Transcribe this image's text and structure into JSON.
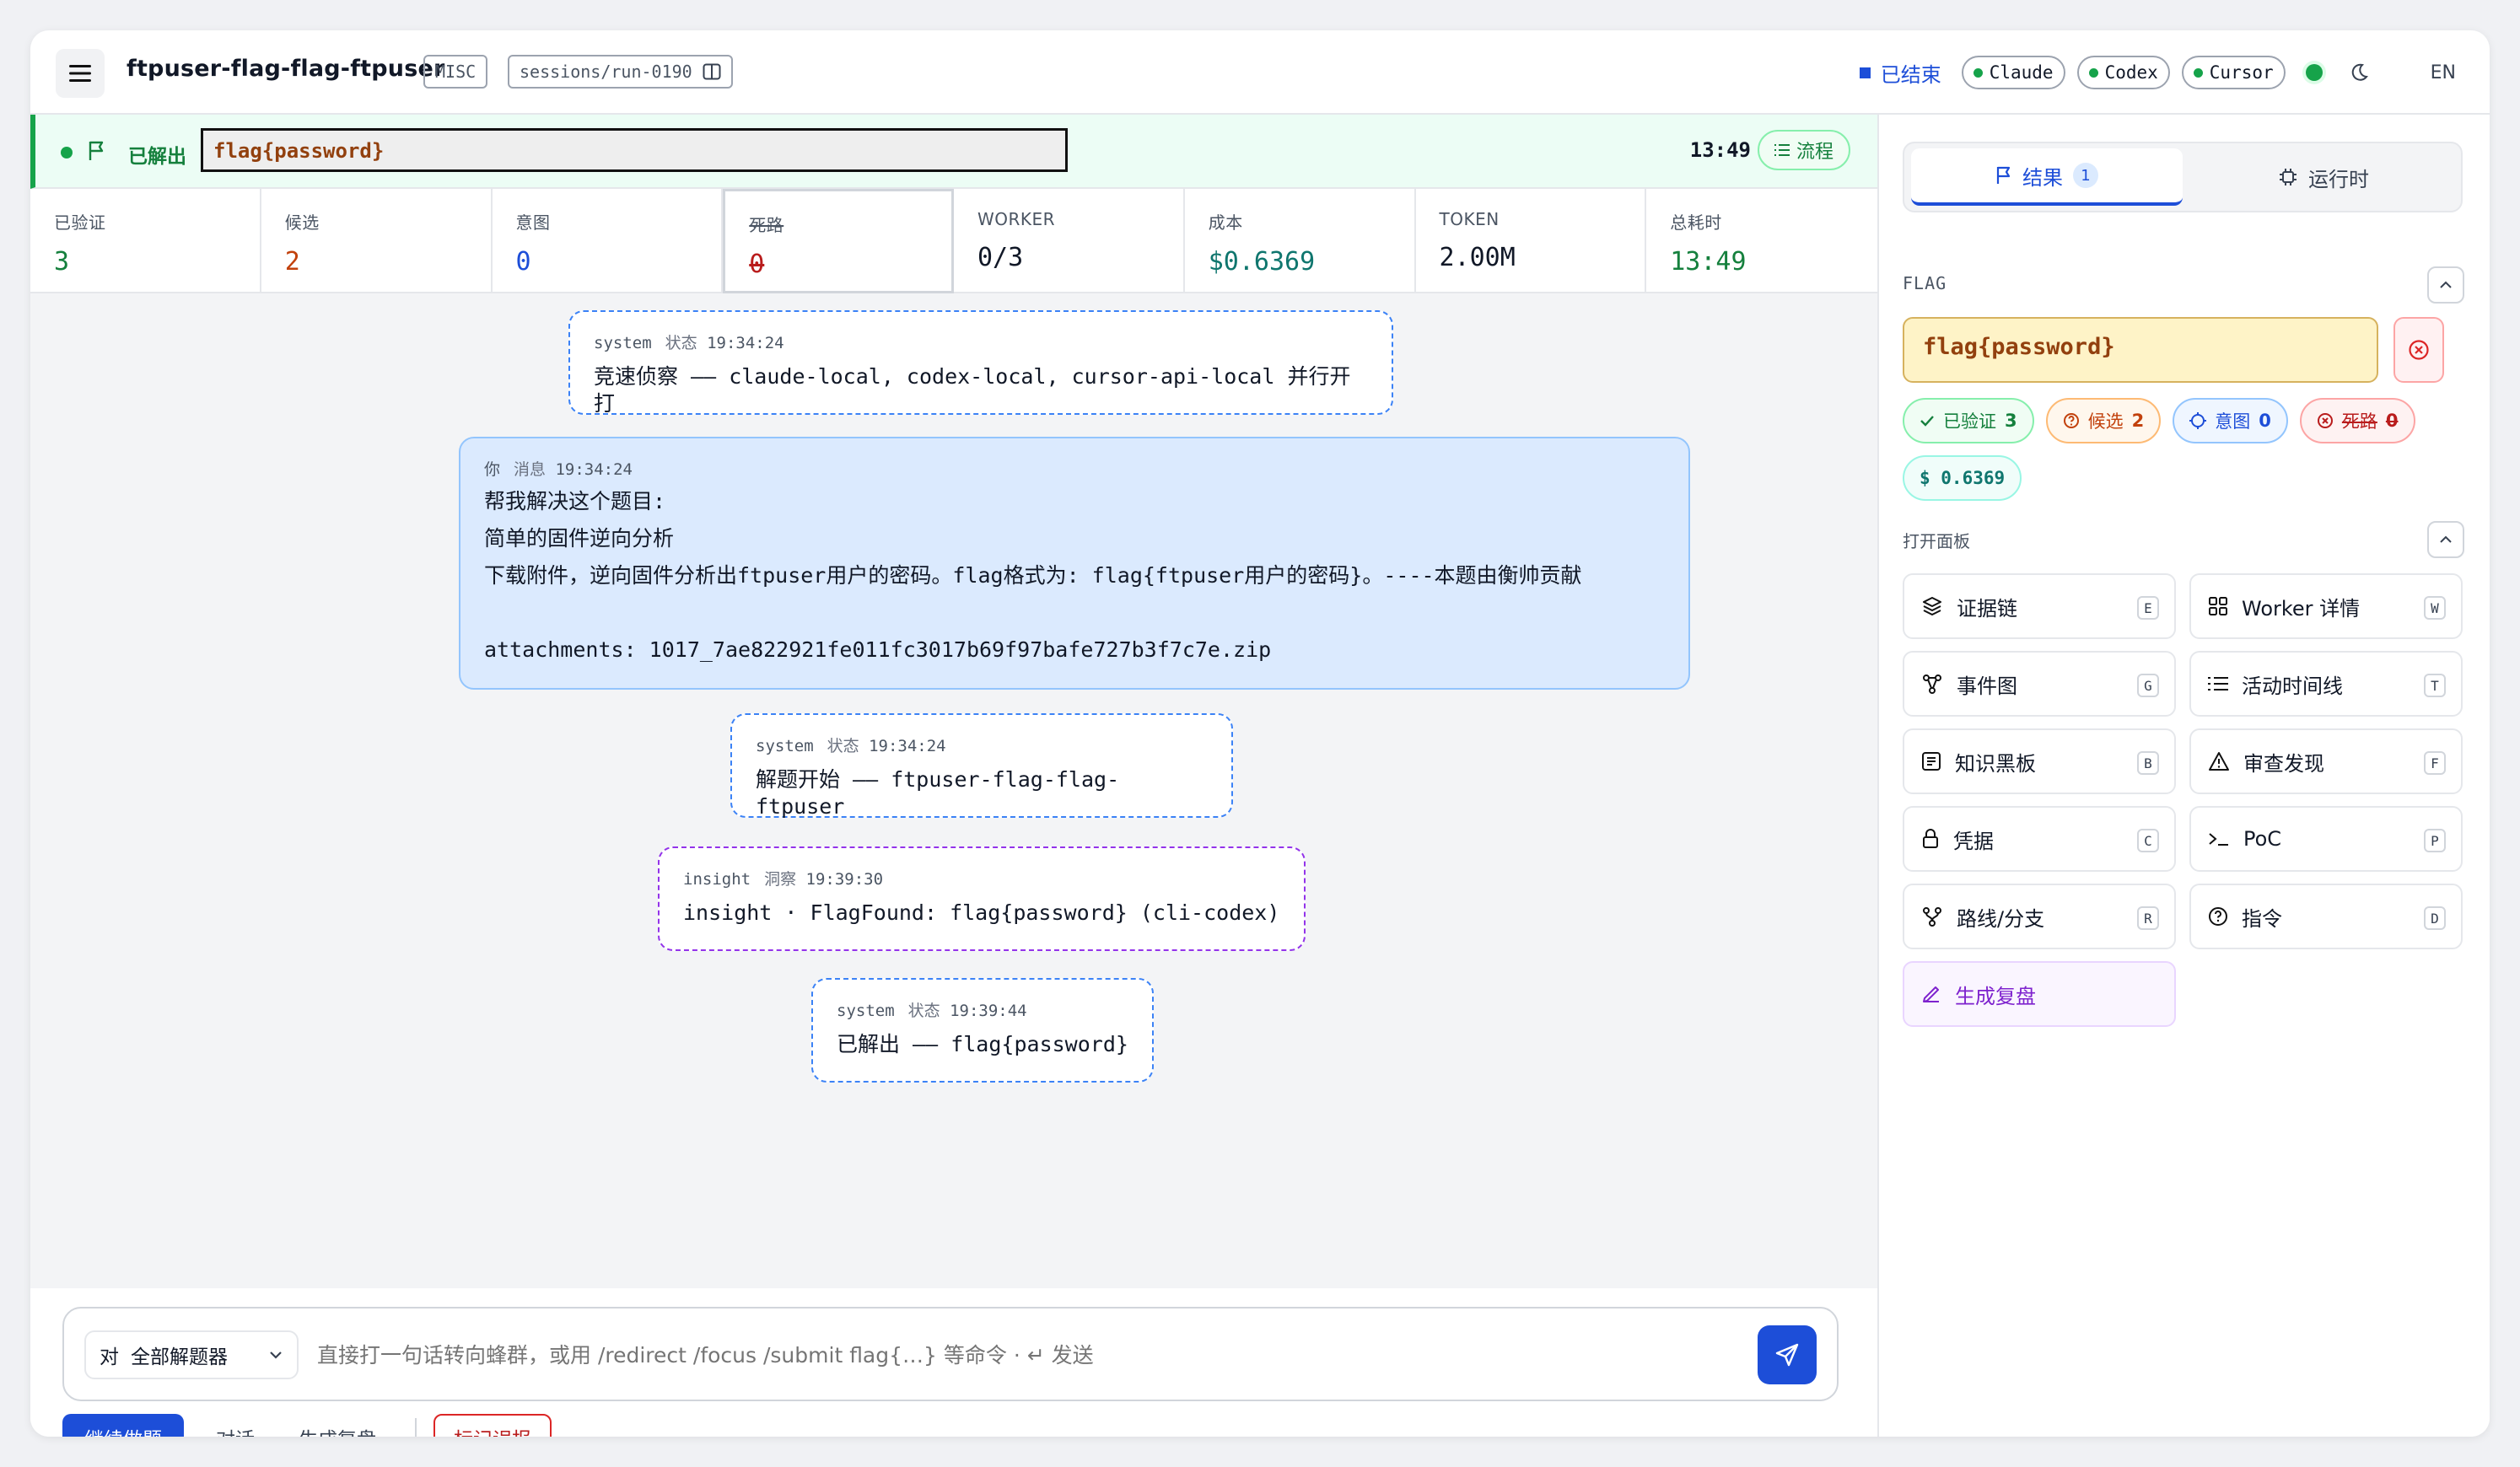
{
  "header": {
    "title": "ftpuser-flag-flag-ftpuser",
    "category_tag": "MISC",
    "session_path": "sessions/run-0190",
    "status": "已结束",
    "agents": [
      "Claude",
      "Codex",
      "Cursor"
    ],
    "lang": "EN"
  },
  "banner": {
    "status": "已解出",
    "flag_value": "flag{password}",
    "elapsed": "13:49",
    "flow_label": "流程"
  },
  "stats": [
    {
      "label": "已验证",
      "value": "3",
      "color": "#15803d"
    },
    {
      "label": "候选",
      "value": "2",
      "color": "#c2410c"
    },
    {
      "label": "意图",
      "value": "0",
      "color": "#1d4ed8"
    },
    {
      "label": "死路",
      "value": "0",
      "color": "#b91c1c"
    },
    {
      "label": "WORKER",
      "value": "0/3",
      "color": "#111827"
    },
    {
      "label": "成本",
      "value": "$0.6369",
      "color": "#0f766e"
    },
    {
      "label": "TOKEN",
      "value": "2.00M",
      "color": "#111827"
    },
    {
      "label": "总耗时",
      "value": "13:49",
      "color": "#15803d"
    }
  ],
  "messages": [
    {
      "sender": "system",
      "kind": "状态",
      "time": "19:34:24",
      "text": "竞速侦察 —— claude-local, codex-local, cursor-api-local 并行开打"
    },
    {
      "sender": "你",
      "kind": "消息",
      "time": "19:34:24",
      "text": "帮我解决这个题目:\n简单的固件逆向分析\n下载附件，逆向固件分析出ftpuser用户的密码。flag格式为: flag{ftpuser用户的密码}。----本题由衡帅贡献\n\nattachments: 1017_7ae822921fe011fc3017b69f97bafe727b3f7c7e.zip"
    },
    {
      "sender": "system",
      "kind": "状态",
      "time": "19:34:24",
      "text": "解题开始 —— ftpuser-flag-flag-ftpuser"
    },
    {
      "sender": "insight",
      "kind": "洞察",
      "time": "19:39:30",
      "text": "insight · FlagFound: flag{password} (cli-codex)"
    },
    {
      "sender": "system",
      "kind": "状态",
      "time": "19:39:44",
      "text": "已解出 —— flag{password}"
    }
  ],
  "composer": {
    "target_prefix": "对",
    "target_value": "全部解题器",
    "placeholder": "直接打一句话转向蜂群，或用 /redirect /focus /submit flag{…} 等命令 · ↵ 发送"
  },
  "actions": {
    "continue": "继续做题",
    "chat": "对话",
    "review": "生成复盘",
    "false_report": "标记误报"
  },
  "right": {
    "tab_results": "结果",
    "tab_results_count": "1",
    "tab_runtime": "运行时",
    "flag_section": "FLAG",
    "flag_value": "flag{password}",
    "pills": [
      {
        "label": "已验证",
        "count": "3"
      },
      {
        "label": "候选",
        "count": "2"
      },
      {
        "label": "意图",
        "count": "0"
      },
      {
        "label": "死路",
        "count": "0"
      },
      {
        "label": "$ 0.6369",
        "count": ""
      }
    ],
    "panels_section": "打开面板",
    "panels": [
      {
        "label": "证据链",
        "key": "E",
        "icon": "layers-icon"
      },
      {
        "label": "Worker 详情",
        "key": "W",
        "icon": "grid-icon"
      },
      {
        "label": "事件图",
        "key": "G",
        "icon": "graph-icon"
      },
      {
        "label": "活动时间线",
        "key": "T",
        "icon": "list-icon"
      },
      {
        "label": "知识黑板",
        "key": "B",
        "icon": "note-icon"
      },
      {
        "label": "审查发现",
        "key": "F",
        "icon": "warning-icon"
      },
      {
        "label": "凭据",
        "key": "C",
        "icon": "lock-icon"
      },
      {
        "label": "PoC",
        "key": "P",
        "icon": "terminal-icon"
      },
      {
        "label": "路线/分支",
        "key": "R",
        "icon": "branch-icon"
      },
      {
        "label": "指令",
        "key": "D",
        "icon": "help-icon"
      }
    ],
    "generate_review": "生成复盘"
  }
}
